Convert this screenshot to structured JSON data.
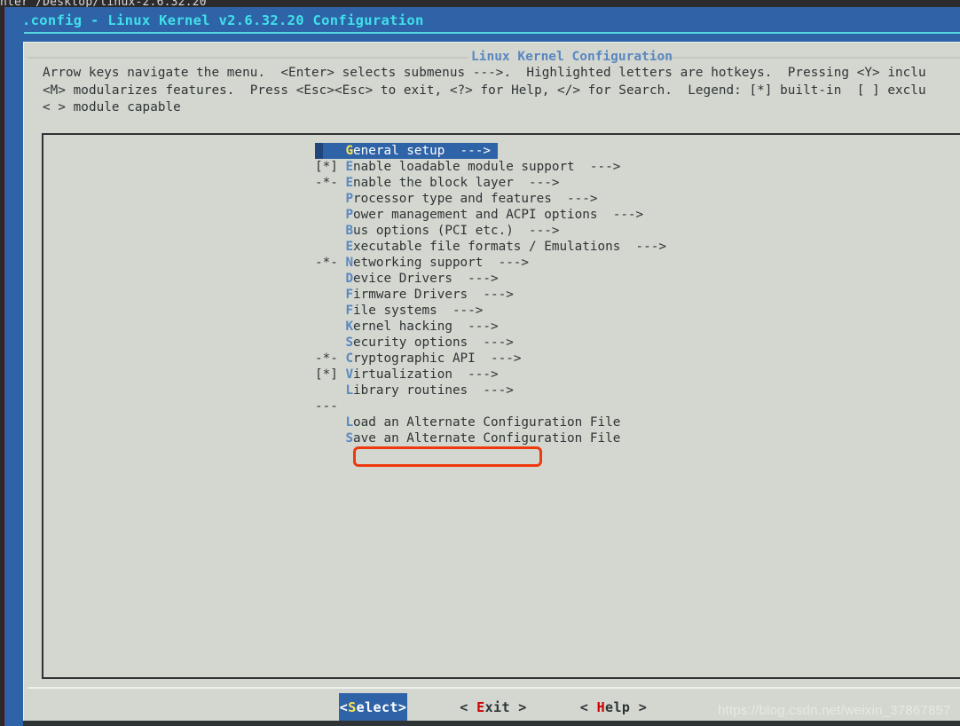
{
  "terminal": {
    "scrollback_line": "nter /Desktop/linux-2.6.32.20"
  },
  "dialog": {
    "title": ".config - Linux Kernel v2.6.32.20 Configuration",
    "frame_title": "Linux Kernel Configuration",
    "help_text": "Arrow keys navigate the menu.  <Enter> selects submenus --->.  Highlighted letters are hotkeys.  Pressing <Y> inclu\n<M> modularizes features.  Press <Esc><Esc> to exit, <?> for Help, </> for Search.  Legend: [*] built-in  [ ] exclu\n< > module capable"
  },
  "menu": {
    "items": [
      {
        "flag": "   ",
        "hotkey": "G",
        "label": "eneral setup",
        "arrow": "  --->",
        "selected": true
      },
      {
        "flag": "[*]",
        "hotkey": "E",
        "label": "nable loadable module support",
        "arrow": "  --->",
        "selected": false
      },
      {
        "flag": "-*-",
        "hotkey": "E",
        "label": "nable the block layer",
        "arrow": "  --->",
        "selected": false
      },
      {
        "flag": "   ",
        "hotkey": "P",
        "label": "rocessor type and features",
        "arrow": "  --->",
        "selected": false
      },
      {
        "flag": "   ",
        "hotkey": "P",
        "label": "ower management and ACPI options",
        "arrow": "  --->",
        "selected": false
      },
      {
        "flag": "   ",
        "hotkey": "B",
        "label": "us options (PCI etc.)",
        "arrow": "  --->",
        "selected": false
      },
      {
        "flag": "   ",
        "hotkey": "E",
        "label": "xecutable file formats / Emulations",
        "arrow": "  --->",
        "selected": false
      },
      {
        "flag": "-*-",
        "hotkey": "N",
        "label": "etworking support",
        "arrow": "  --->",
        "selected": false
      },
      {
        "flag": "   ",
        "hotkey": "D",
        "label": "evice Drivers",
        "arrow": "  --->",
        "selected": false
      },
      {
        "flag": "   ",
        "hotkey": "F",
        "label": "irmware Drivers",
        "arrow": "  --->",
        "selected": false
      },
      {
        "flag": "   ",
        "hotkey": "F",
        "label": "ile systems",
        "arrow": "  --->",
        "selected": false
      },
      {
        "flag": "   ",
        "hotkey": "K",
        "label": "ernel hacking",
        "arrow": "  --->",
        "selected": false,
        "annotated": true
      },
      {
        "flag": "   ",
        "hotkey": "S",
        "label": "ecurity options",
        "arrow": "  --->",
        "selected": false
      },
      {
        "flag": "-*-",
        "hotkey": "C",
        "label": "ryptographic API",
        "arrow": "  --->",
        "selected": false
      },
      {
        "flag": "[*]",
        "hotkey": "V",
        "label": "irtualization",
        "arrow": "  --->",
        "selected": false
      },
      {
        "flag": "   ",
        "hotkey": "L",
        "label": "ibrary routines",
        "arrow": "  --->",
        "selected": false
      },
      {
        "flag": "---",
        "hotkey": "",
        "label": "",
        "arrow": "",
        "selected": false
      },
      {
        "flag": "   ",
        "hotkey": "L",
        "label": "oad an Alternate Configuration File",
        "arrow": "",
        "selected": false
      },
      {
        "flag": "   ",
        "hotkey": "S",
        "label": "ave an Alternate Configuration File",
        "arrow": "",
        "selected": false
      }
    ]
  },
  "buttons": [
    {
      "prefix": "<",
      "hot": "S",
      "rest": "elect>",
      "active": true
    },
    {
      "prefix": "< ",
      "hot": "E",
      "rest": "xit >",
      "active": false
    },
    {
      "prefix": "< ",
      "hot": "H",
      "rest": "elp >",
      "active": false
    }
  ],
  "watermark": {
    "text": "https://blog.csdn.net/weixin_37867857"
  },
  "colors": {
    "dialog_blue": "#2f63a8",
    "title_cyan": "#3fe0e8",
    "body_grey": "#d3d7cf",
    "hotkey_blue": "#5a87c0",
    "selected_hotkey": "#ffe44d",
    "button_hotkey_red": "#cc0000",
    "annotation_red": "#f0380f",
    "text_dark": "#2e3436"
  }
}
